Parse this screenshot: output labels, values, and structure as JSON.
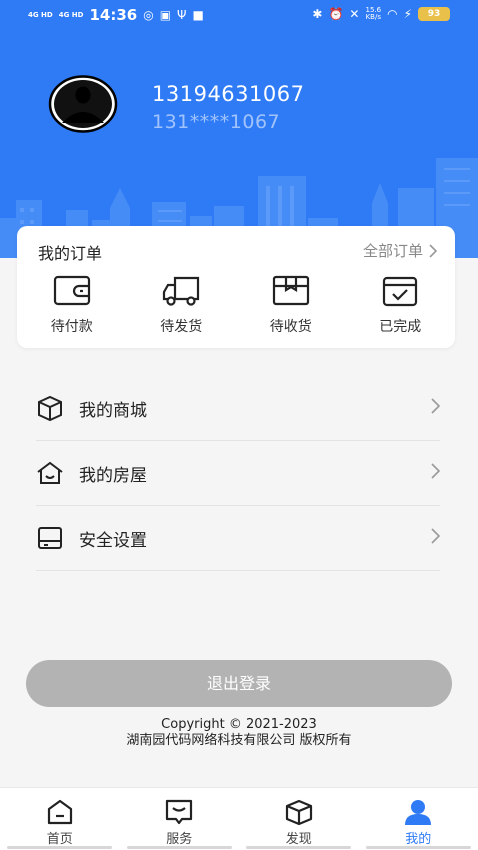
{
  "status_bar": {
    "signal1": "4G HD",
    "signal2": "4G HD",
    "time": "14:36",
    "net_speed_value": "15.6",
    "net_speed_unit": "KB/s",
    "battery": "93"
  },
  "profile": {
    "phone": "13194631067",
    "phone_masked": "131****1067"
  },
  "orders": {
    "title": "我的订单",
    "all_label": "全部订单",
    "items": [
      {
        "label": "待付款",
        "icon": "wallet-icon"
      },
      {
        "label": "待发货",
        "icon": "truck-icon"
      },
      {
        "label": "待收货",
        "icon": "package-icon"
      },
      {
        "label": "已完成",
        "icon": "completed-icon"
      }
    ]
  },
  "menu": [
    {
      "label": "我的商城",
      "icon": "box-icon"
    },
    {
      "label": "我的房屋",
      "icon": "house-icon"
    },
    {
      "label": "安全设置",
      "icon": "device-icon"
    }
  ],
  "logout_label": "退出登录",
  "footer": {
    "copyright_line1": "Copyright  © 2021-2023",
    "copyright_line2": "湖南园代码网络科技有限公司 版权所有"
  },
  "tabs": [
    {
      "label": "首页",
      "icon": "home-icon",
      "active": false
    },
    {
      "label": "服务",
      "icon": "service-icon",
      "active": false
    },
    {
      "label": "发现",
      "icon": "discover-icon",
      "active": false
    },
    {
      "label": "我的",
      "icon": "profile-icon",
      "active": true
    }
  ],
  "colors": {
    "brand": "#2f7bf6",
    "logout_bg": "#b3b3b3"
  }
}
